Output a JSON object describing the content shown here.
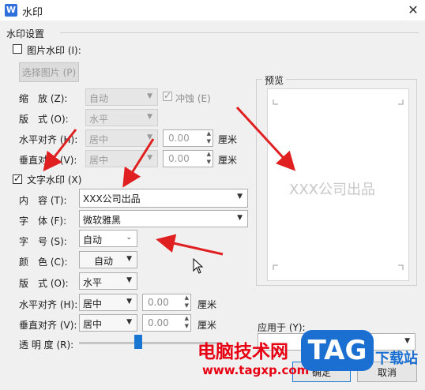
{
  "window": {
    "app_icon": "W",
    "title": "水印",
    "close": "✕"
  },
  "group": {
    "title": "水印设置"
  },
  "picture": {
    "checkbox_label": "图片水印 (I):",
    "select_button": "选择图片 (P)",
    "scale_label": "缩　放 (Z):",
    "scale_value": "自动",
    "washout_label": "冲蚀 (E)",
    "layout_label": "版　式 (O):",
    "layout_value": "水平",
    "halign_label": "水平对齐 (H):",
    "halign_value": "居中",
    "halign_offset": "0.00",
    "halign_unit": "厘米",
    "valign_label": "垂直对齐 (V):",
    "valign_value": "居中",
    "valign_offset": "0.00",
    "valign_unit": "厘米"
  },
  "text": {
    "checkbox_label": "文字水印 (X)",
    "content_label": "内　容 (T):",
    "content_value": "XXX公司出品",
    "font_label": "字　体 (F):",
    "font_value": "微软雅黑",
    "size_label": "字　号 (S):",
    "size_value": "自动",
    "color_label": "颜　色 (C):",
    "color_value": "自动",
    "layout_label": "版　式 (O):",
    "layout_value": "水平",
    "halign_label": "水平对齐 (H):",
    "halign_value": "居中",
    "halign_offset": "0.00",
    "halign_unit": "厘米",
    "valign_label": "垂直对齐 (V):",
    "valign_value": "居中",
    "valign_offset": "0.00",
    "valign_unit": "厘米",
    "transparency_label": "透 明 度 (R):",
    "transparency_value": 0.4
  },
  "preview": {
    "label": "预览",
    "watermark_text": "XXX公司出品"
  },
  "apply": {
    "label": "应用于 (Y):"
  },
  "buttons": {
    "ok": "确定",
    "cancel": "取消"
  },
  "overlay": {
    "brand_text": "电脑技术网",
    "url": "www.tagxp.com",
    "logo": "TAG",
    "side_text": "下载站"
  },
  "colors": {
    "accent": "#1976d2",
    "annotation": "#e02020",
    "overlay_red": "#e60012",
    "logo_blue": "#1a6fd1"
  }
}
